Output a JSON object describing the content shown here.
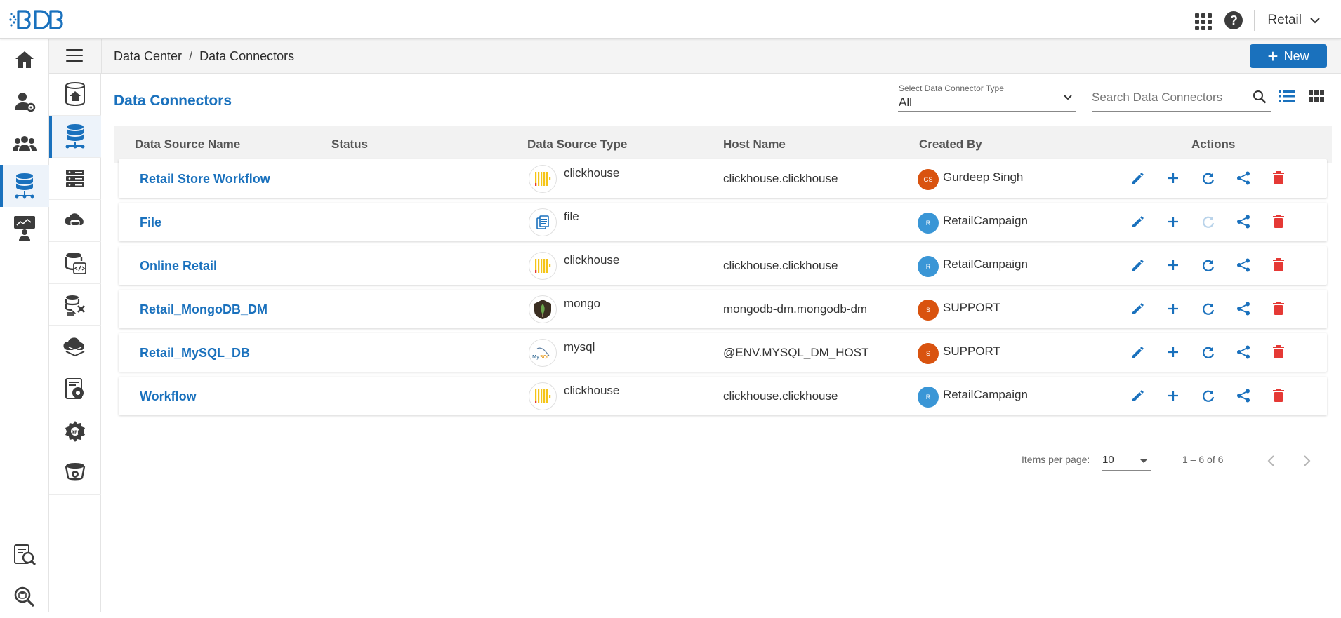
{
  "topbar": {
    "logo_text": "BDB",
    "apps_icon": "apps-grid-icon",
    "help_icon": "help-circle-icon",
    "help_glyph": "?",
    "space_name": "Retail",
    "space_chevron": "chevron-down-icon"
  },
  "rail": {
    "items": [
      {
        "icon": "home-icon"
      },
      {
        "icon": "user-settings-icon"
      },
      {
        "icon": "users-group-icon"
      },
      {
        "icon": "data-center-icon",
        "active": true
      },
      {
        "icon": "presentation-icon"
      },
      {
        "icon": "data-search-icon"
      },
      {
        "icon": "search-icon"
      }
    ]
  },
  "subrail": {
    "items": [
      {
        "icon": "database-home-icon"
      },
      {
        "icon": "database-connector-icon",
        "active": true
      },
      {
        "icon": "server-stack-icon"
      },
      {
        "icon": "cloud-database-icon"
      },
      {
        "icon": "database-code-icon"
      },
      {
        "icon": "dataset-transform-icon"
      },
      {
        "icon": "cloud-layers-icon"
      },
      {
        "icon": "settings-data-icon"
      },
      {
        "icon": "api-gear-icon"
      },
      {
        "icon": "bucket-gear-icon"
      }
    ]
  },
  "breadcrumb": {
    "items": [
      "Data Center",
      "Data Connectors"
    ],
    "separator": "/"
  },
  "new_button": {
    "label": "New",
    "plus": "+",
    "color": "#1a71bd"
  },
  "page_title": "Data Connectors",
  "type_filter": {
    "label": "Select Data Connector Type",
    "value": "All"
  },
  "search": {
    "placeholder": "Search Data Connectors",
    "value": ""
  },
  "view_toggle": {
    "list_icon": "list-view-icon",
    "grid_icon": "grid-view-icon"
  },
  "table": {
    "columns": [
      "Data Source Name",
      "Status",
      "Data Source Type",
      "Host Name",
      "Created By",
      "Actions"
    ],
    "rows": [
      {
        "name": "Retail Store Workflow",
        "status": "",
        "type": "clickhouse",
        "type_icon": "clickhouse-icon",
        "host": "clickhouse.clickhouse",
        "creator": "Gurdeep Singh",
        "initials": "GS",
        "avatar_color": "#d9530f",
        "refresh_disabled": false
      },
      {
        "name": "File",
        "status": "",
        "type": "file",
        "type_icon": "file-icon",
        "host": "",
        "creator": "RetailCampaign",
        "initials": "R",
        "avatar_color": "#3a96d6",
        "refresh_disabled": true
      },
      {
        "name": "Online Retail",
        "status": "",
        "type": "clickhouse",
        "type_icon": "clickhouse-icon",
        "host": "clickhouse.clickhouse",
        "creator": "RetailCampaign",
        "initials": "R",
        "avatar_color": "#3a96d6",
        "refresh_disabled": false
      },
      {
        "name": "Retail_MongoDB_DM",
        "status": "",
        "type": "mongo",
        "type_icon": "mongodb-icon",
        "host": "mongodb-dm.mongodb-dm",
        "creator": "SUPPORT",
        "initials": "S",
        "avatar_color": "#d9530f",
        "refresh_disabled": false
      },
      {
        "name": "Retail_MySQL_DB",
        "status": "",
        "type": "mysql",
        "type_icon": "mysql-icon",
        "host": "@ENV.MYSQL_DM_HOST",
        "creator": "SUPPORT",
        "initials": "S",
        "avatar_color": "#d9530f",
        "refresh_disabled": false
      },
      {
        "name": "Workflow",
        "status": "",
        "type": "clickhouse",
        "type_icon": "clickhouse-icon",
        "host": "clickhouse.clickhouse",
        "creator": "RetailCampaign",
        "initials": "R",
        "avatar_color": "#3a96d6",
        "refresh_disabled": false
      }
    ],
    "action_icons": [
      "edit-icon",
      "add-icon",
      "refresh-icon",
      "share-icon",
      "delete-icon"
    ],
    "action_color": "#1a71bd",
    "delete_color": "#e53935"
  },
  "pagination": {
    "items_per_page_label": "Items per page:",
    "items_per_page": "10",
    "range": "1 – 6 of 6",
    "prev_icon": "chevron-left-icon",
    "next_icon": "chevron-right-icon"
  }
}
